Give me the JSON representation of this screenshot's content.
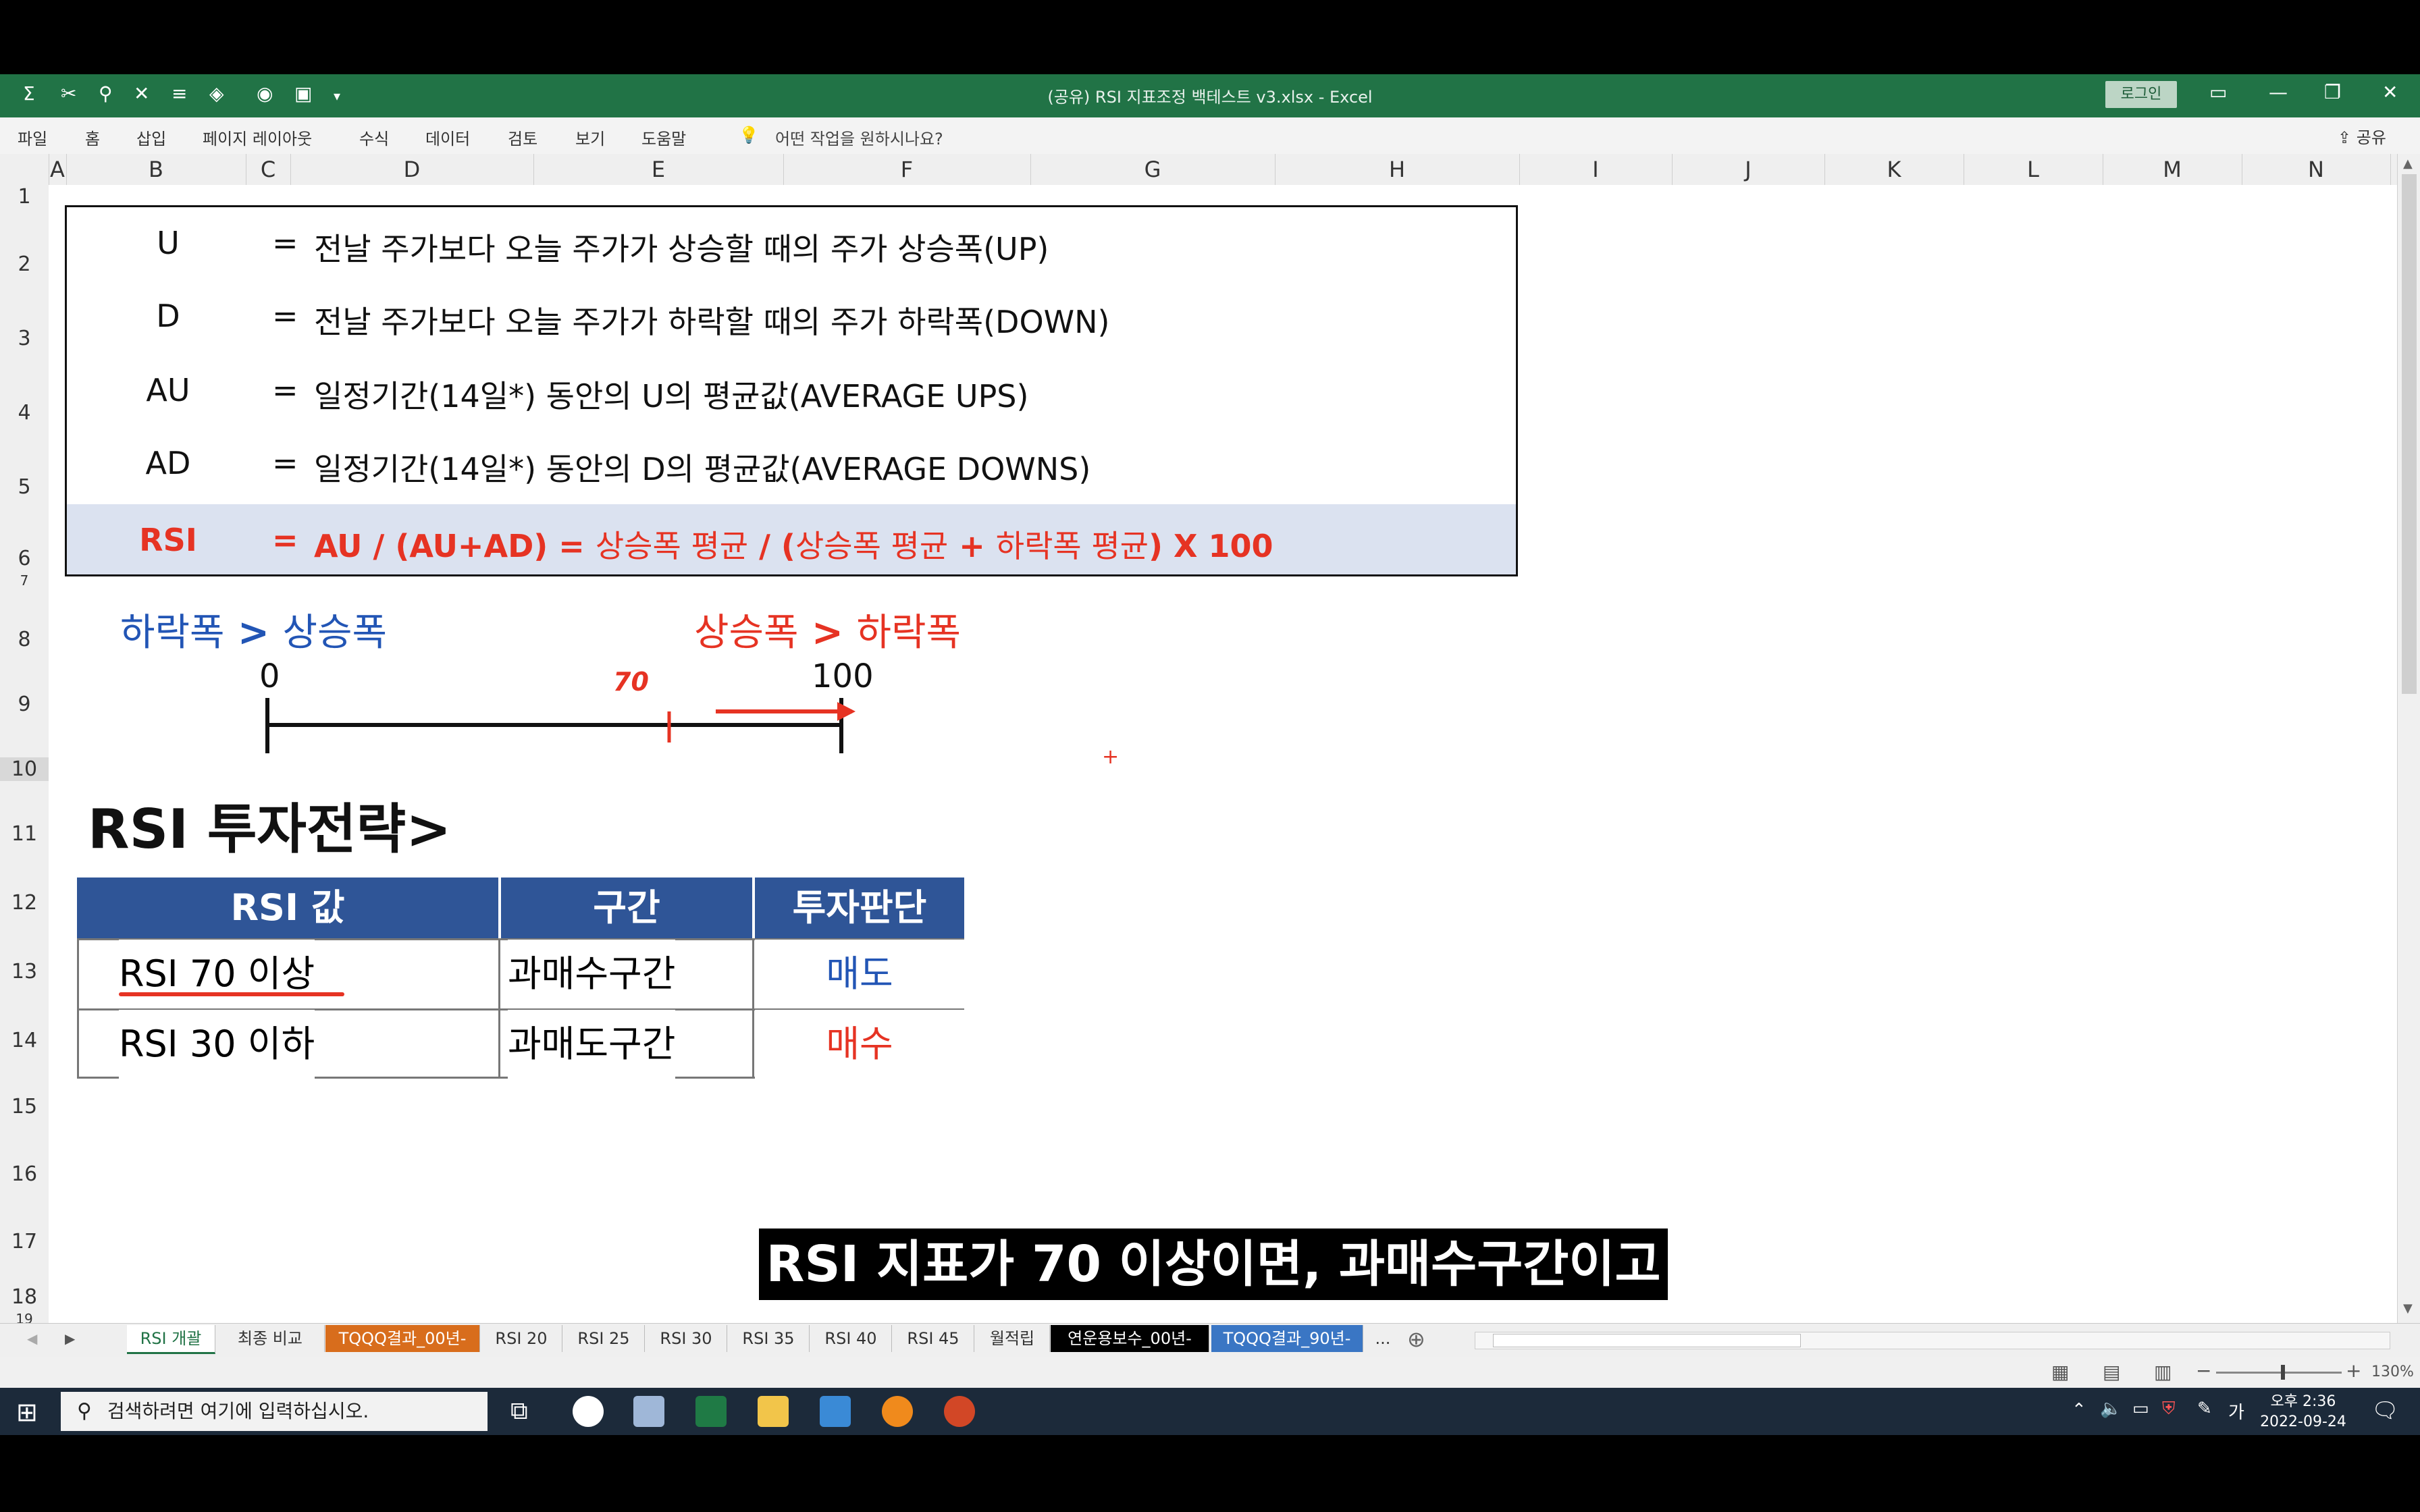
{
  "window": {
    "title": "(공유) RSI 지표조정 백테스트 v3.xlsx  -  Excel",
    "login_label": "로그인",
    "share_label": "공유"
  },
  "ribbon": {
    "tabs": [
      "파일",
      "홈",
      "삽입",
      "페이지 레이아웃",
      "수식",
      "데이터",
      "검토",
      "보기",
      "도움말"
    ],
    "tell_me": "어떤 작업을 원하시나요?"
  },
  "columns": [
    "A",
    "B",
    "C",
    "D",
    "E",
    "F",
    "G",
    "H",
    "I",
    "J",
    "K",
    "L",
    "M",
    "N"
  ],
  "rows": [
    "1",
    "2",
    "3",
    "4",
    "5",
    "6",
    "7",
    "8",
    "9",
    "10",
    "11",
    "12",
    "13",
    "14",
    "15",
    "16",
    "17",
    "18",
    "19"
  ],
  "definitions": [
    {
      "term": "U",
      "eq": "=",
      "desc": "전날 주가보다 오늘 주가가 상승할 때의 주가 상승폭(UP)"
    },
    {
      "term": "D",
      "eq": "=",
      "desc": "전날 주가보다 오늘 주가가 하락할 때의 주가 하락폭(DOWN)"
    },
    {
      "term": "AU",
      "eq": "=",
      "desc": "일정기간(14일*) 동안의 U의 평균값(AVERAGE UPS)"
    },
    {
      "term": "AD",
      "eq": "=",
      "desc": "일정기간(14일*) 동안의 D의 평균값(AVERAGE DOWNS)"
    }
  ],
  "rsi_formula": {
    "term": "RSI",
    "eq": "=",
    "part1": "AU / (AU+AD) = ",
    "part2": "상승폭 평균",
    "part3": " / (",
    "part4": "상승폭 평균",
    "part5": " + ",
    "part6": "하락폭 평균",
    "part7": ") X 100"
  },
  "scale": {
    "left_label_a": "하락폭",
    "left_gt": " > ",
    "left_label_b": "상승폭",
    "right_label_a": "상승폭",
    "right_gt": " > ",
    "right_label_b": "하락폭",
    "min": "0",
    "max": "100",
    "marker": "70",
    "marker_value": 70
  },
  "strategy": {
    "title": "RSI 투자전략>",
    "headers": [
      "RSI 값",
      "구간",
      "투자판단"
    ],
    "rows": [
      {
        "value": "RSI 70 이상",
        "zone": "과매수구간",
        "decision": "매도"
      },
      {
        "value": "RSI 30 이하",
        "zone": "과매도구간",
        "decision": "매수"
      }
    ]
  },
  "subtitle": "RSI 지표가 70 이상이면, 과매수구간이고",
  "sheet_tabs": [
    "RSI 개괄",
    "최종 비교",
    "TQQQ결과_00년-",
    "RSI 20",
    "RSI 25",
    "RSI 30",
    "RSI 35",
    "RSI 40",
    "RSI 45",
    "월적립",
    "연운용보수_00년-",
    "TQQQ결과_90년-",
    "..."
  ],
  "status": {
    "zoom": "130%"
  },
  "taskbar": {
    "search_placeholder": "검색하려면 여기에 입력하십시오.",
    "time": "오후 2:36",
    "date": "2022-09-24",
    "ime": "가"
  },
  "colors": {
    "excel_green": "#217346",
    "header_blue": "#2f5597",
    "text_blue": "#2255b5",
    "text_red": "#e63323",
    "rsi_row_bg": "#dbe2f0"
  }
}
